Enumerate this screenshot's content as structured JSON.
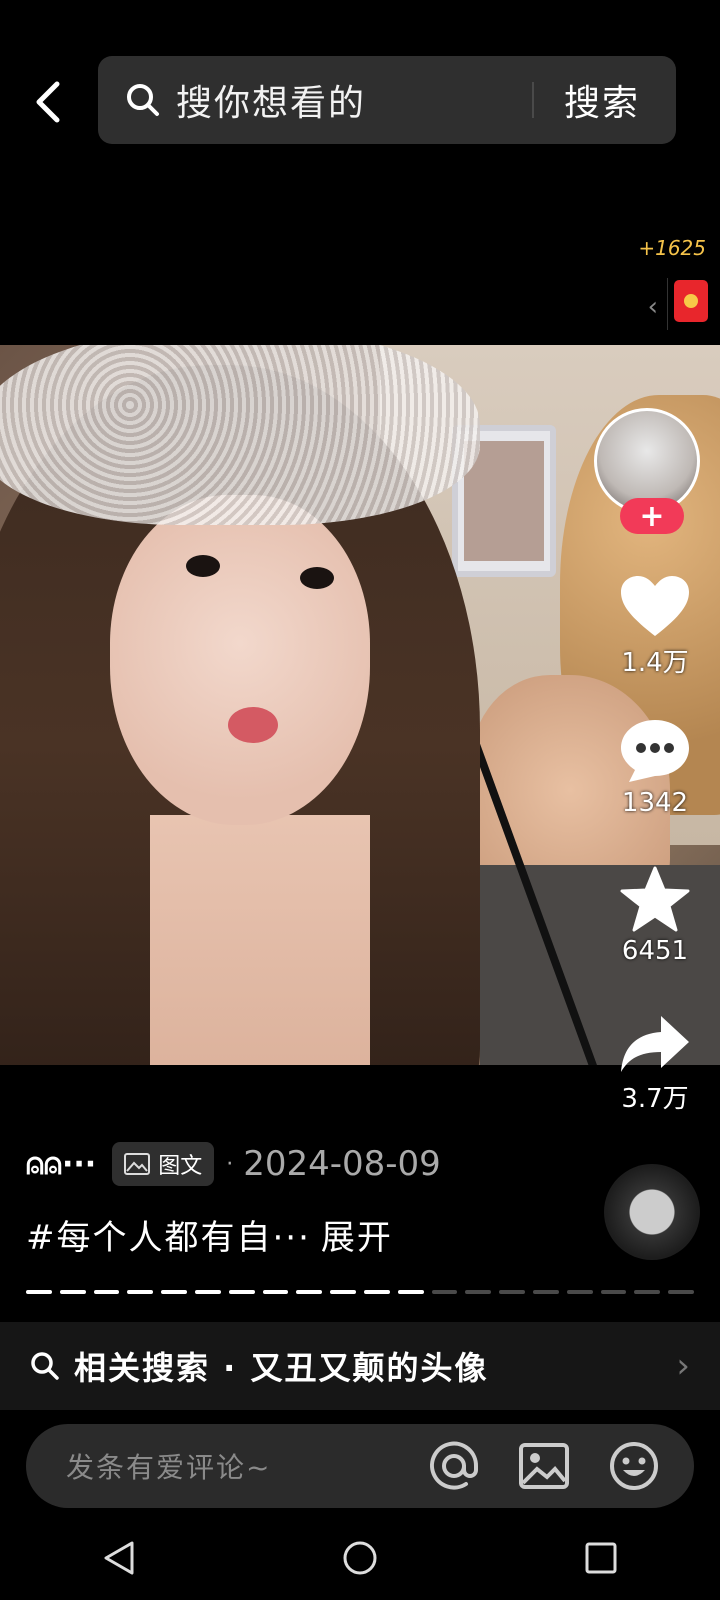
{
  "top_bar": {
    "search_placeholder": "搜你想看的",
    "search_button": "搜索",
    "coins": "+1625"
  },
  "post": {
    "actions": {
      "like_count": "1.4万",
      "comment_count": "1342",
      "favorite_count": "6451",
      "share_count": "3.7万"
    },
    "username": "⍝⍝···",
    "type_tag": "图文",
    "separator": "·",
    "date": "2024-08-09",
    "caption": "#每个人都有自···",
    "expand_label": "展开",
    "progress": {
      "total_segments": 20,
      "active_segments": 12
    }
  },
  "related_search": {
    "label": "相关搜索 · 又丑又颠的头像"
  },
  "comment_bar": {
    "placeholder": "发条有爱评论~"
  },
  "icons": {
    "back": "back-chevron-icon",
    "search": "search-icon",
    "red_packet": "red-packet-icon",
    "like": "heart-icon",
    "comment": "comment-bubble-icon",
    "favorite": "star-icon",
    "share": "share-arrow-icon",
    "mention": "at-icon",
    "image": "image-icon",
    "emoji": "emoji-icon"
  },
  "colors": {
    "follow_button": "#f23a58",
    "coins_text": "#f5c34a",
    "red_packet": "#e8262c"
  }
}
